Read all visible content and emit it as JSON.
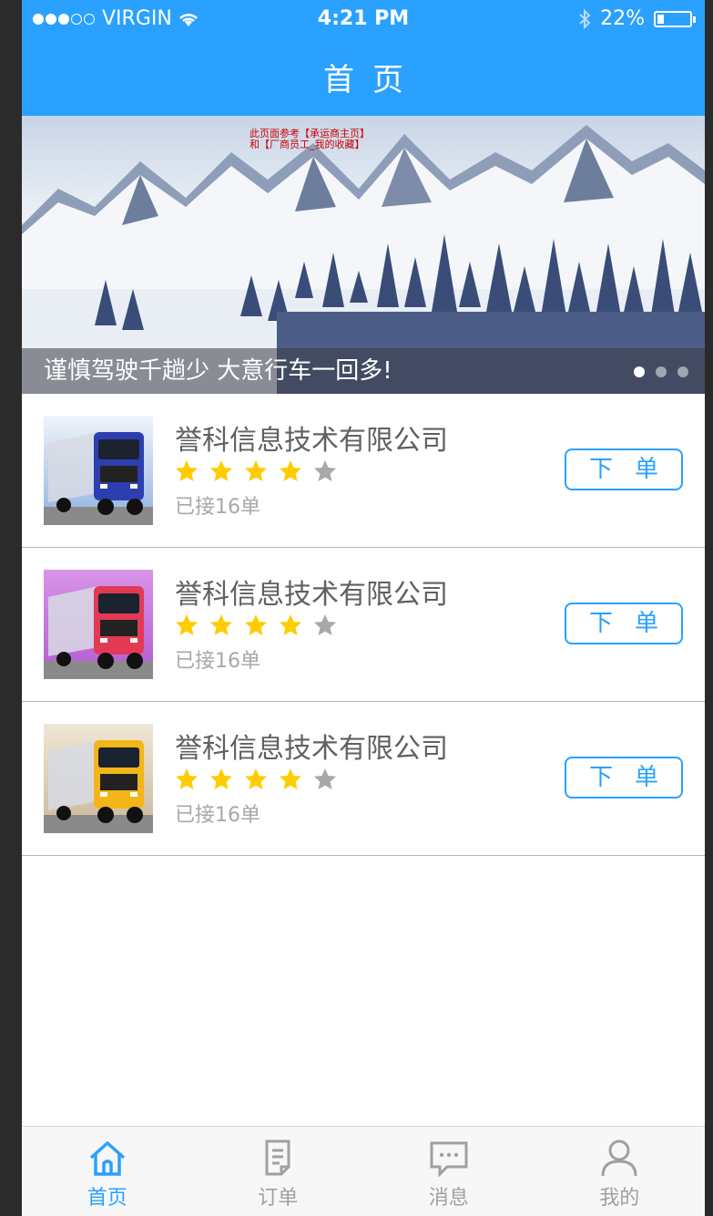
{
  "status_bar": {
    "carrier": "VIRGIN",
    "time": "4:21 PM",
    "battery": "22%",
    "battery_level": 0.22
  },
  "header": {
    "title": "首页"
  },
  "banner": {
    "caption": "谨慎驾驶千趟少 大意行车一回多!",
    "note": "此页面参考【承运商主页】和【厂商员工_我的收藏】",
    "pages": 3,
    "active_page": 0
  },
  "companies": [
    {
      "name": "誉科信息技术有限公司",
      "orders": "已接16单",
      "rating": 4,
      "button": "下单",
      "truck_color": "#2d3fb0"
    },
    {
      "name": "誉科信息技术有限公司",
      "orders": "已接16单",
      "rating": 4,
      "button": "下单",
      "truck_color": "#e23a55"
    },
    {
      "name": "誉科信息技术有限公司",
      "orders": "已接16单",
      "rating": 4,
      "button": "下单",
      "truck_color": "#f2b619"
    }
  ],
  "tabs": [
    {
      "label": "首页",
      "icon": "home-icon",
      "active": true
    },
    {
      "label": "订单",
      "icon": "order-icon",
      "active": false
    },
    {
      "label": "消息",
      "icon": "message-icon",
      "active": false
    },
    {
      "label": "我的",
      "icon": "profile-icon",
      "active": false
    }
  ],
  "colors": {
    "accent": "#2aa1ff",
    "title_text": "#606060",
    "sub_text": "#a8a8a8",
    "divider": "#b7b7b7",
    "star_on": "#ffcc00",
    "star_off": "#a8a8a8"
  }
}
